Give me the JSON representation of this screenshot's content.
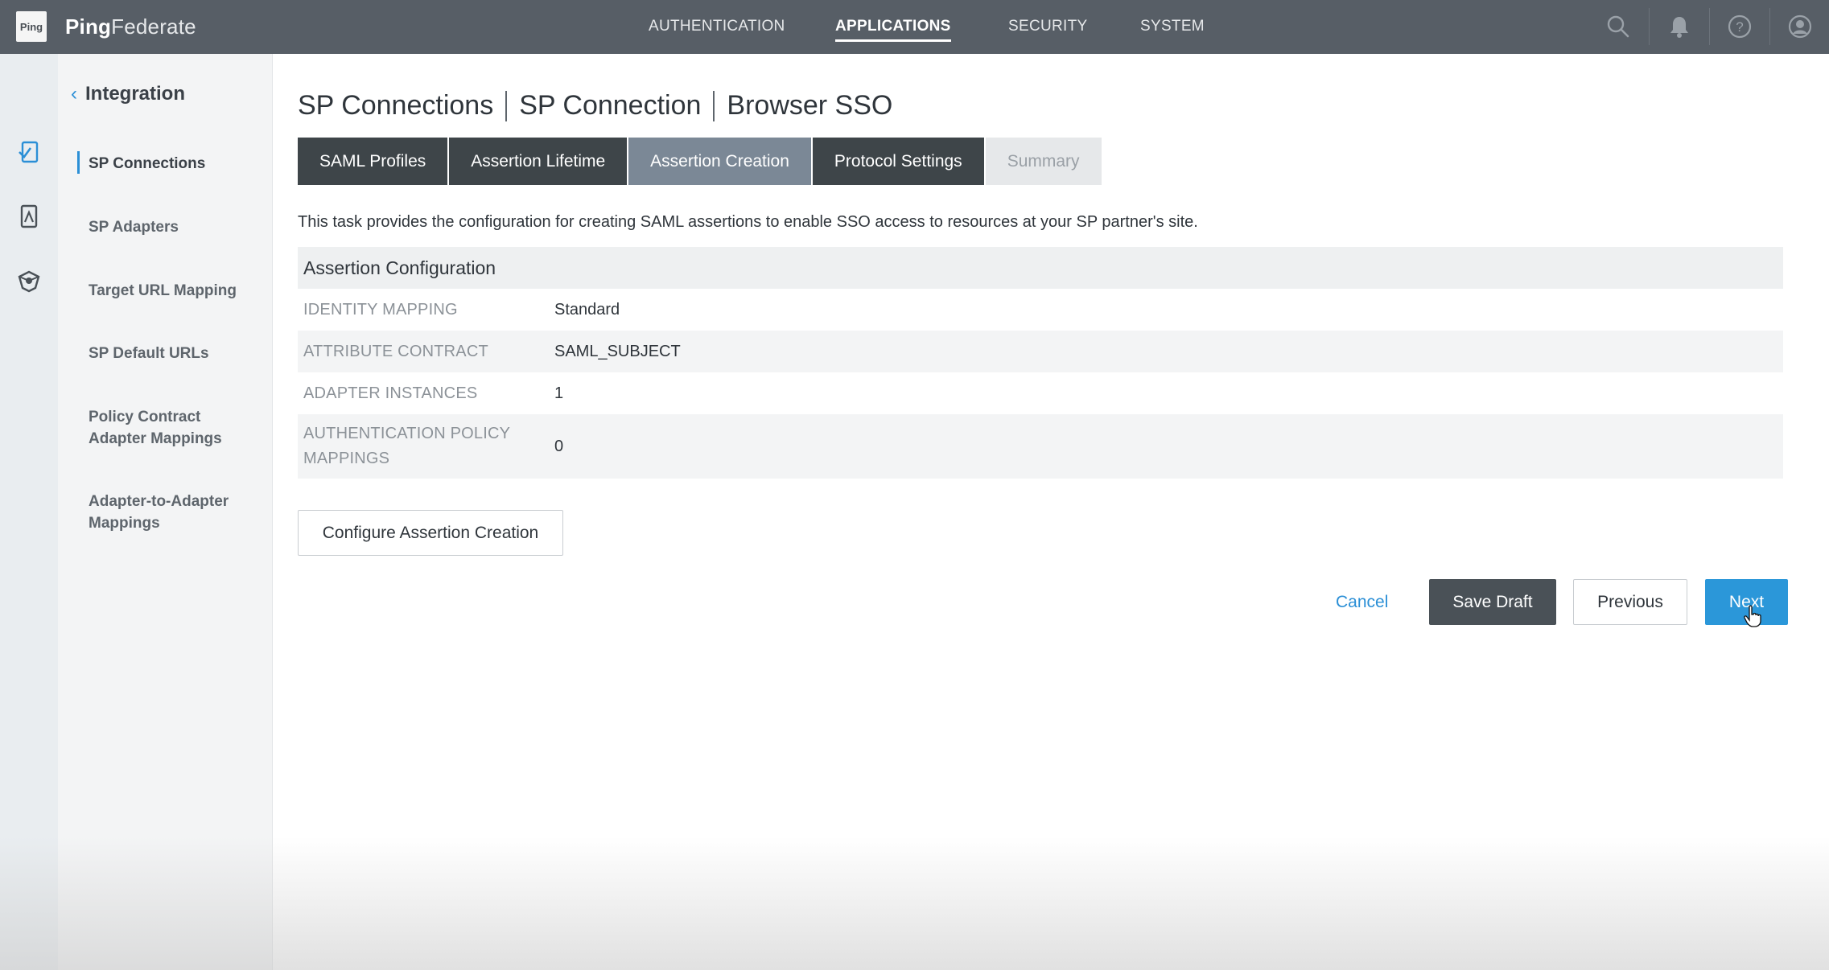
{
  "app": {
    "logo_text": "Ping",
    "brand_bold": "Ping",
    "brand_light": "Federate"
  },
  "nav": {
    "items": [
      {
        "label": "AUTHENTICATION"
      },
      {
        "label": "APPLICATIONS",
        "active": true
      },
      {
        "label": "SECURITY"
      },
      {
        "label": "SYSTEM"
      }
    ]
  },
  "header_icons": [
    "search-icon",
    "bell-icon",
    "help-icon",
    "user-icon"
  ],
  "rail_icons": [
    "applications-icon",
    "mobile-app-icon",
    "oauth-icon"
  ],
  "sidebar": {
    "back_label": "Integration",
    "items": [
      {
        "label": "SP Connections",
        "active": true
      },
      {
        "label": "SP Adapters"
      },
      {
        "label": "Target URL Mapping"
      },
      {
        "label": "SP Default URLs"
      },
      {
        "label": "Policy Contract Adapter Mappings"
      },
      {
        "label": "Adapter-to-Adapter Mappings"
      }
    ]
  },
  "breadcrumbs": [
    "SP Connections",
    "SP Connection",
    "Browser SSO"
  ],
  "tabs": [
    {
      "label": "SAML Profiles"
    },
    {
      "label": "Assertion Lifetime"
    },
    {
      "label": "Assertion Creation",
      "current": true
    },
    {
      "label": "Protocol Settings"
    },
    {
      "label": "Summary",
      "disabled": true
    }
  ],
  "description": "This task provides the configuration for creating SAML assertions to enable SSO access to resources at your SP partner's site.",
  "assertion_config": {
    "title": "Assertion Configuration",
    "rows": [
      {
        "key": "IDENTITY MAPPING",
        "value": "Standard"
      },
      {
        "key": "ATTRIBUTE CONTRACT",
        "value": "SAML_SUBJECT"
      },
      {
        "key": "ADAPTER INSTANCES",
        "value": "1"
      },
      {
        "key": "AUTHENTICATION POLICY MAPPINGS",
        "value": "0"
      }
    ]
  },
  "actions": {
    "configure": "Configure Assertion Creation",
    "cancel": "Cancel",
    "save_draft": "Save Draft",
    "previous": "Previous",
    "next": "Next"
  },
  "colors": {
    "topbar": "#575e66",
    "accent": "#2b97d9",
    "tab_dark": "#3e4549",
    "tab_current": "#7b8896"
  }
}
